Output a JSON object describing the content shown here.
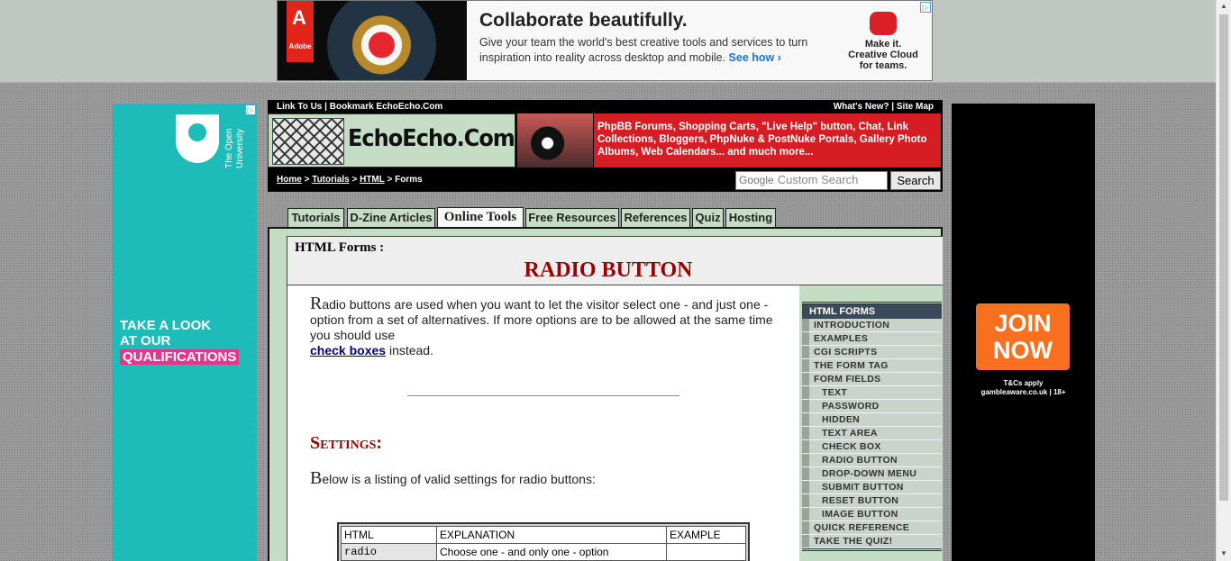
{
  "top_ad": {
    "brand": "Adobe",
    "headline": "Collaborate beautifully.",
    "body": "Give your team the world's best creative tools and services to turn inspiration into reality across desktop and mobile.",
    "link": "See how ›",
    "tagline": "Make it. Creative Cloud for teams."
  },
  "left_ad": {
    "brand": "The Open University",
    "line1": "TAKE A LOOK",
    "line2": "AT OUR",
    "line3": "QUALIFICATIONS"
  },
  "right_ad": {
    "button": "JOIN NOW",
    "terms": "T&Cs apply",
    "site": "gambleaware.co.uk | 18+"
  },
  "header": {
    "link_to_us": "Link To Us",
    "bookmark": "Bookmark EchoEcho.Com",
    "whats_new": "What's New?",
    "site_map": "Site Map",
    "logo_text": "EchoEcho.Com",
    "promo": "PhpBB Forums, Shopping Carts, \"Live Help\" button, Chat, Link Collections, Bloggers, PhpNuke & PostNuke Portals, Gallery Photo Albums, Web Calendars... and much more...",
    "search_placeholder": "Custom Search",
    "search_brand": "Google",
    "search_button": "Search"
  },
  "breadcrumb": {
    "home": "Home",
    "tutorials": "Tutorials",
    "html": "HTML",
    "current": "Forms"
  },
  "tabs": [
    "Tutorials",
    "D-Zine Articles",
    "Online Tools",
    "Free Resources",
    "References",
    "Quiz",
    "Hosting"
  ],
  "page": {
    "section": "HTML Forms :",
    "title": "RADIO BUTTON",
    "intro_first": "R",
    "intro_rest": "adio buttons are used when you want to let the visitor select one - and just one - option from a set of alternatives. If more options are to be allowed at the same time you should use",
    "intro_link": "check boxes",
    "intro_after": "instead.",
    "settings_heading": "Settings:",
    "settings_first": "B",
    "settings_rest": "elow is a listing of valid settings for radio buttons:"
  },
  "table": {
    "headers": [
      "HTML",
      "EXPLANATION",
      "EXAMPLE"
    ],
    "rows": [
      [
        "radio",
        "Choose one - and only one - option",
        ""
      ]
    ]
  },
  "menu": {
    "heading": "HTML FORMS",
    "items": [
      "INTRODUCTION",
      "EXAMPLES",
      "CGI SCRIPTS",
      "THE FORM TAG",
      "FORM FIELDS"
    ],
    "subitems": [
      "TEXT",
      "PASSWORD",
      "HIDDEN",
      "TEXT AREA",
      "CHECK BOX",
      "RADIO BUTTON",
      "DROP-DOWN MENU",
      "SUBMIT BUTTON",
      "RESET BUTTON",
      "IMAGE BUTTON"
    ],
    "tail": [
      "QUICK REFERENCE",
      "TAKE THE QUIZ!"
    ]
  }
}
